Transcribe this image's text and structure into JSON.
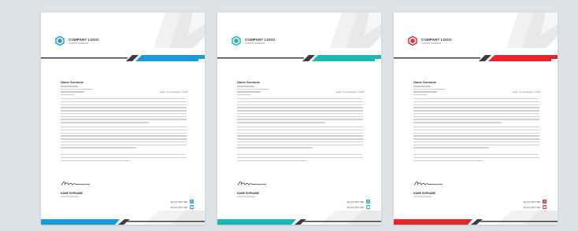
{
  "colors": {
    "background": "#dfe2e6",
    "dark_stripe": "#3a3d42",
    "accent_blue": "#1a9ad8",
    "accent_teal": "#1bb7b5",
    "accent_red": "#e3262b"
  },
  "letterheads": [
    {
      "accent": "#1a9ad8",
      "logo_title": "COMPANY LOGO",
      "logo_tagline": "Graphic Solutions",
      "recipient_name": "Name Surname",
      "date": "Date: 14 September, 2018",
      "signature_name": "NAME SURNAME",
      "signature_title": "General Manager",
      "contacts": [
        "+00 123 4567 890",
        "+00 123 4567 890",
        "www.website.com",
        "address here, city"
      ]
    },
    {
      "accent": "#1bb7b5",
      "logo_title": "COMPANY LOGO",
      "logo_tagline": "Graphic Solutions",
      "recipient_name": "Name Surname",
      "date": "Date: 14 September, 2018",
      "signature_name": "NAME SURNAME",
      "signature_title": "General Manager",
      "contacts": [
        "+00 123 4567 890",
        "+00 123 4567 890",
        "www.website.com",
        "address here, city"
      ]
    },
    {
      "accent": "#e3262b",
      "logo_title": "COMPANY LOGO",
      "logo_tagline": "Graphic Solutions",
      "recipient_name": "Name Surname",
      "date": "Date: 14 September, 2018",
      "signature_name": "NAME SURNAME",
      "signature_title": "General Manager",
      "contacts": [
        "+00 123 4567 890",
        "+00 123 4567 890",
        "www.website.com",
        "address here, city"
      ]
    }
  ],
  "icons": [
    "phone-icon",
    "fax-icon",
    "globe-icon",
    "location-icon"
  ]
}
